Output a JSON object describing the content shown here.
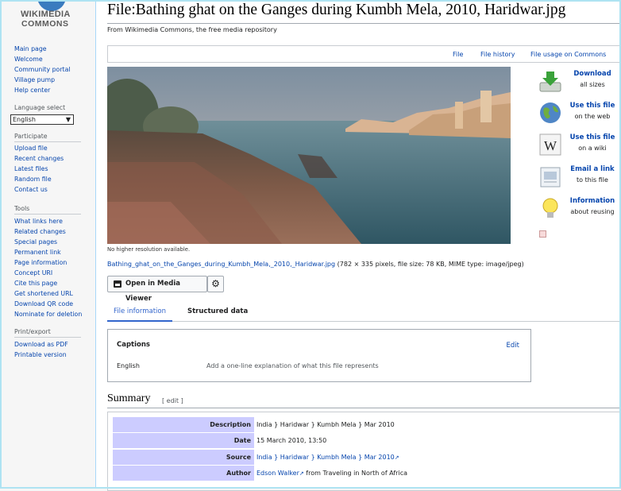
{
  "logo": {
    "line1": "WIKIMEDIA",
    "line2": "COMMONS"
  },
  "sidebar": {
    "main_items": [
      "Main page",
      "Welcome",
      "Community portal",
      "Village pump",
      "Help center"
    ],
    "language_heading": "Language select",
    "language_value": "English",
    "participate_heading": "Participate",
    "participate_items": [
      "Upload file",
      "Recent changes",
      "Latest files",
      "Random file",
      "Contact us"
    ],
    "tools_heading": "Tools",
    "tools_items": [
      "What links here",
      "Related changes",
      "Special pages",
      "Permanent link",
      "Page information",
      "Concept URI",
      "Cite this page",
      "Get shortened URL",
      "Download QR code",
      "Nominate for deletion"
    ],
    "print_heading": "Print/export",
    "print_items": [
      "Download as PDF",
      "Printable version"
    ]
  },
  "page": {
    "title": "File:Bathing ghat on the Ganges during Kumbh Mela, 2010, Haridwar.jpg",
    "tagline": "From Wikimedia Commons, the free media repository"
  },
  "file_tabs": [
    "File",
    "File history",
    "File usage on Commons"
  ],
  "image": {
    "no_higher": "No higher resolution available.",
    "filename_link": "Bathing_ghat_on_the_Ganges_during_Kumbh_Mela,_2010,_Haridwar.jpg",
    "file_details": " (782 × 335 pixels, file size: 78 KB, MIME type: image/jpeg)"
  },
  "buttons": {
    "media_viewer": "Open in Media Viewer"
  },
  "actions": [
    {
      "title": "Download",
      "sub": "all sizes",
      "icon": "download-icon"
    },
    {
      "title": "Use this file",
      "sub": "on the web",
      "icon": "globe-icon"
    },
    {
      "title": "Use this file",
      "sub": "on a wiki",
      "icon": "wikipedia-icon"
    },
    {
      "title": "Email a link",
      "sub": "to this file",
      "icon": "email-icon"
    },
    {
      "title": "Information",
      "sub": "about reusing",
      "icon": "lightbulb-icon"
    }
  ],
  "content_tabs": {
    "file_info": "File information",
    "structured": "Structured data"
  },
  "captions": {
    "heading": "Captions",
    "edit": "Edit",
    "language": "English",
    "placeholder": "Add a one-line explanation of what this file represents"
  },
  "summary": {
    "heading": "Summary",
    "edit": "[ edit ]",
    "rows": [
      {
        "key": "Description",
        "value": "India } Haridwar } Kumbh Mela } Mar 2010",
        "link": false
      },
      {
        "key": "Date",
        "value": "15 March 2010, 13:50",
        "link": false
      },
      {
        "key": "Source",
        "value": "India } Haridwar } Kumbh Mela } Mar 2010",
        "link": true
      },
      {
        "key": "Author",
        "value": "Edson Walker",
        "after": " from Traveling in North of Africa",
        "link": true
      }
    ]
  },
  "colors": {
    "link": "#0645ad",
    "summary_key_bg": "#ccccff",
    "frame": "#aee3f2"
  }
}
